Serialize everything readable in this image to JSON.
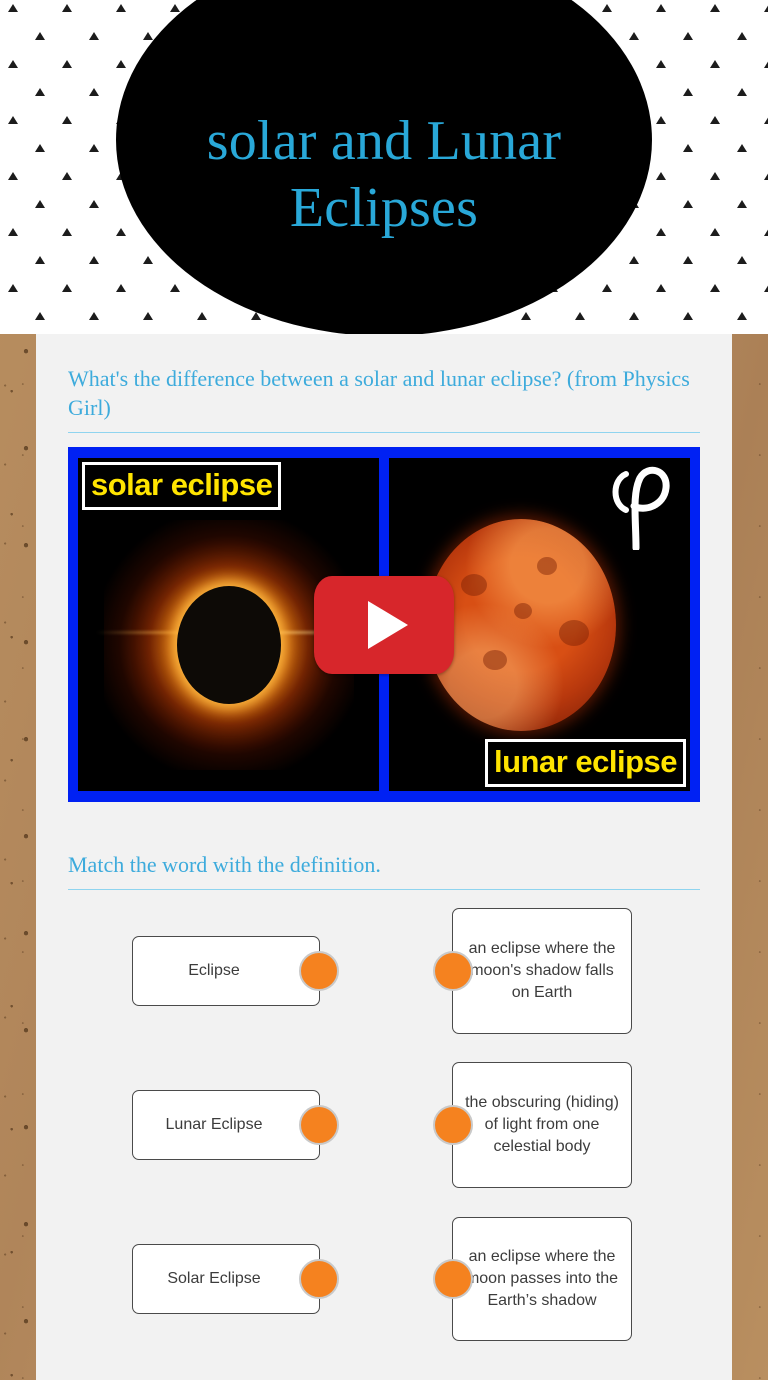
{
  "banner": {
    "title_line1": "solar and Lunar",
    "title_line2": "Eclipses",
    "title_color": "#29a8d8",
    "ellipse_color": "#000000",
    "pattern": "triangle-pattern"
  },
  "card": {
    "background_color": "#f2f2f2"
  },
  "video_section": {
    "heading": "What's the difference between a solar and lunar eclipse? (from Physics Girl)",
    "thumbnail": {
      "border_color": "#0021f3",
      "left_label": "solar eclipse",
      "right_label": "lunar eclipse",
      "label_text_color": "#ffe400",
      "play_button_color": "#d7262b",
      "logo": "physics-girl-logo"
    }
  },
  "match_section": {
    "heading": "Match the word with the definition.",
    "dot_color": "#f5821f",
    "terms": [
      {
        "label": "Eclipse"
      },
      {
        "label": "Lunar Eclipse"
      },
      {
        "label": "Solar Eclipse"
      }
    ],
    "definitions": [
      {
        "label": "an eclipse where the moon's shadow falls on Earth"
      },
      {
        "label": "the obscuring (hiding) of light from one celestial body"
      },
      {
        "label": "an eclipse where the moon passes into the Earth’s shadow"
      }
    ]
  }
}
